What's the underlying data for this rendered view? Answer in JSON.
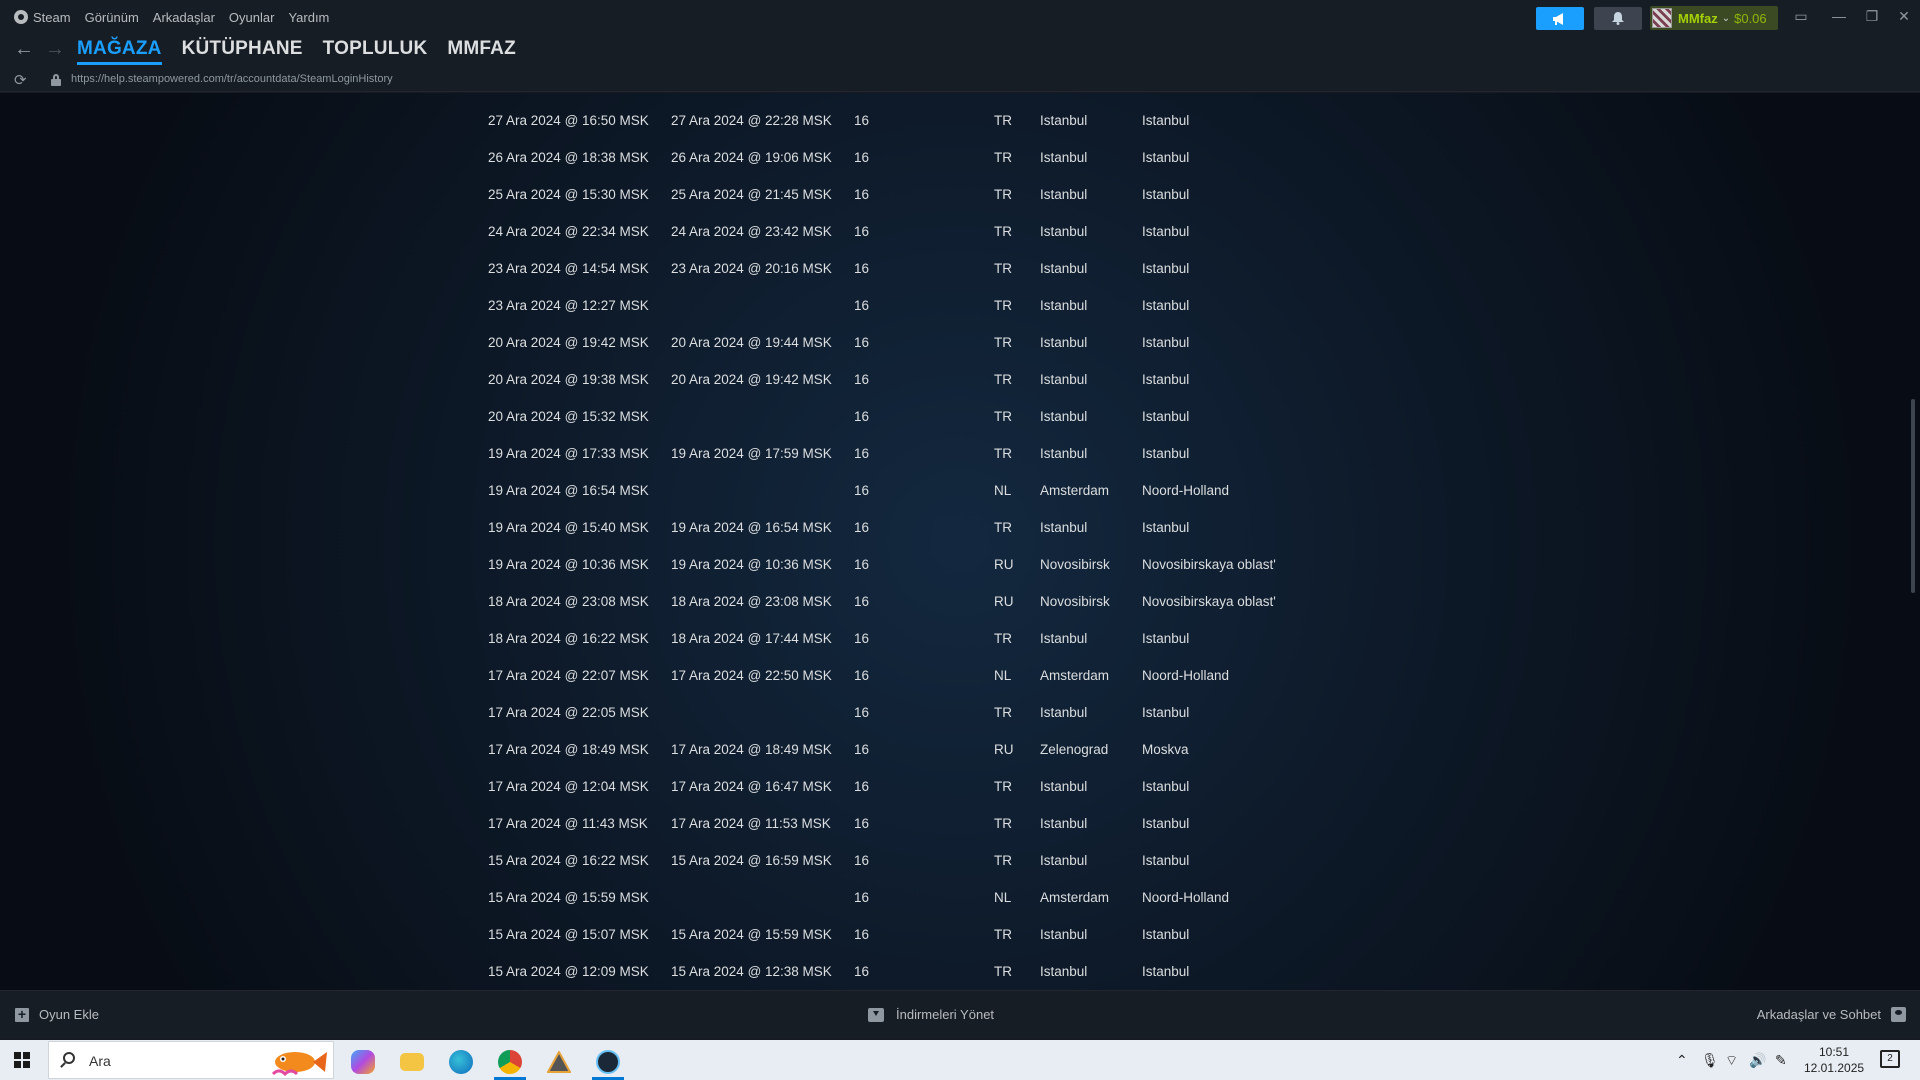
{
  "menu": {
    "app_name": "Steam",
    "items": [
      "Görünüm",
      "Arkadaşlar",
      "Oyunlar",
      "Yardım"
    ]
  },
  "account": {
    "name": "MMfaz",
    "balance": "$0.06"
  },
  "nav": {
    "tabs": [
      "MAĞAZA",
      "KÜTÜPHANE",
      "TOPLULUK",
      "MMFAZ"
    ],
    "active_tab": "MAĞAZA"
  },
  "url": "https://help.steampowered.com/tr/accountdata/SteamLoginHistory",
  "login_history": [
    {
      "login": "27 Ara 2024 @ 16:50 MSK",
      "logout": "27 Ara 2024 @ 22:28 MSK",
      "os": "16",
      "country": "TR",
      "city": "Istanbul",
      "region": "Istanbul"
    },
    {
      "login": "26 Ara 2024 @ 18:38 MSK",
      "logout": "26 Ara 2024 @ 19:06 MSK",
      "os": "16",
      "country": "TR",
      "city": "Istanbul",
      "region": "Istanbul"
    },
    {
      "login": "25 Ara 2024 @ 15:30 MSK",
      "logout": "25 Ara 2024 @ 21:45 MSK",
      "os": "16",
      "country": "TR",
      "city": "Istanbul",
      "region": "Istanbul"
    },
    {
      "login": "24 Ara 2024 @ 22:34 MSK",
      "logout": "24 Ara 2024 @ 23:42 MSK",
      "os": "16",
      "country": "TR",
      "city": "Istanbul",
      "region": "Istanbul"
    },
    {
      "login": "23 Ara 2024 @ 14:54 MSK",
      "logout": "23 Ara 2024 @ 20:16 MSK",
      "os": "16",
      "country": "TR",
      "city": "Istanbul",
      "region": "Istanbul"
    },
    {
      "login": "23 Ara 2024 @ 12:27 MSK",
      "logout": "",
      "os": "16",
      "country": "TR",
      "city": "Istanbul",
      "region": "Istanbul"
    },
    {
      "login": "20 Ara 2024 @ 19:42 MSK",
      "logout": "20 Ara 2024 @ 19:44 MSK",
      "os": "16",
      "country": "TR",
      "city": "Istanbul",
      "region": "Istanbul"
    },
    {
      "login": "20 Ara 2024 @ 19:38 MSK",
      "logout": "20 Ara 2024 @ 19:42 MSK",
      "os": "16",
      "country": "TR",
      "city": "Istanbul",
      "region": "Istanbul"
    },
    {
      "login": "20 Ara 2024 @ 15:32 MSK",
      "logout": "",
      "os": "16",
      "country": "TR",
      "city": "Istanbul",
      "region": "Istanbul"
    },
    {
      "login": "19 Ara 2024 @ 17:33 MSK",
      "logout": "19 Ara 2024 @ 17:59 MSK",
      "os": "16",
      "country": "TR",
      "city": "Istanbul",
      "region": "Istanbul"
    },
    {
      "login": "19 Ara 2024 @ 16:54 MSK",
      "logout": "",
      "os": "16",
      "country": "NL",
      "city": "Amsterdam",
      "region": "Noord-Holland"
    },
    {
      "login": "19 Ara 2024 @ 15:40 MSK",
      "logout": "19 Ara 2024 @ 16:54 MSK",
      "os": "16",
      "country": "TR",
      "city": "Istanbul",
      "region": "Istanbul"
    },
    {
      "login": "19 Ara 2024 @ 10:36 MSK",
      "logout": "19 Ara 2024 @ 10:36 MSK",
      "os": "16",
      "country": "RU",
      "city": "Novosibirsk",
      "region": "Novosibirskaya oblast'"
    },
    {
      "login": "18 Ara 2024 @ 23:08 MSK",
      "logout": "18 Ara 2024 @ 23:08 MSK",
      "os": "16",
      "country": "RU",
      "city": "Novosibirsk",
      "region": "Novosibirskaya oblast'"
    },
    {
      "login": "18 Ara 2024 @ 16:22 MSK",
      "logout": "18 Ara 2024 @ 17:44 MSK",
      "os": "16",
      "country": "TR",
      "city": "Istanbul",
      "region": "Istanbul"
    },
    {
      "login": "17 Ara 2024 @ 22:07 MSK",
      "logout": "17 Ara 2024 @ 22:50 MSK",
      "os": "16",
      "country": "NL",
      "city": "Amsterdam",
      "region": "Noord-Holland"
    },
    {
      "login": "17 Ara 2024 @ 22:05 MSK",
      "logout": "",
      "os": "16",
      "country": "TR",
      "city": "Istanbul",
      "region": "Istanbul"
    },
    {
      "login": "17 Ara 2024 @ 18:49 MSK",
      "logout": "17 Ara 2024 @ 18:49 MSK",
      "os": "16",
      "country": "RU",
      "city": "Zelenograd",
      "region": "Moskva"
    },
    {
      "login": "17 Ara 2024 @ 12:04 MSK",
      "logout": "17 Ara 2024 @ 16:47 MSK",
      "os": "16",
      "country": "TR",
      "city": "Istanbul",
      "region": "Istanbul"
    },
    {
      "login": "17 Ara 2024 @ 11:43 MSK",
      "logout": "17 Ara 2024 @ 11:53 MSK",
      "os": "16",
      "country": "TR",
      "city": "Istanbul",
      "region": "Istanbul"
    },
    {
      "login": "15 Ara 2024 @ 16:22 MSK",
      "logout": "15 Ara 2024 @ 16:59 MSK",
      "os": "16",
      "country": "TR",
      "city": "Istanbul",
      "region": "Istanbul"
    },
    {
      "login": "15 Ara 2024 @ 15:59 MSK",
      "logout": "",
      "os": "16",
      "country": "NL",
      "city": "Amsterdam",
      "region": "Noord-Holland"
    },
    {
      "login": "15 Ara 2024 @ 15:07 MSK",
      "logout": "15 Ara 2024 @ 15:59 MSK",
      "os": "16",
      "country": "TR",
      "city": "Istanbul",
      "region": "Istanbul"
    },
    {
      "login": "15 Ara 2024 @ 12:09 MSK",
      "logout": "15 Ara 2024 @ 12:38 MSK",
      "os": "16",
      "country": "TR",
      "city": "Istanbul",
      "region": "Istanbul"
    }
  ],
  "bottom_bar": {
    "add_game": "Oyun Ekle",
    "downloads": "İndirmeleri Yönet",
    "friends": "Arkadaşlar ve Sohbet"
  },
  "taskbar": {
    "search_placeholder": "Ara",
    "time": "10:51",
    "date": "12.01.2025",
    "notification_count": "2"
  },
  "colors": {
    "accent": "#1a9fff",
    "wallet_green": "#a4d007",
    "chrome_bg": "#171d25"
  }
}
